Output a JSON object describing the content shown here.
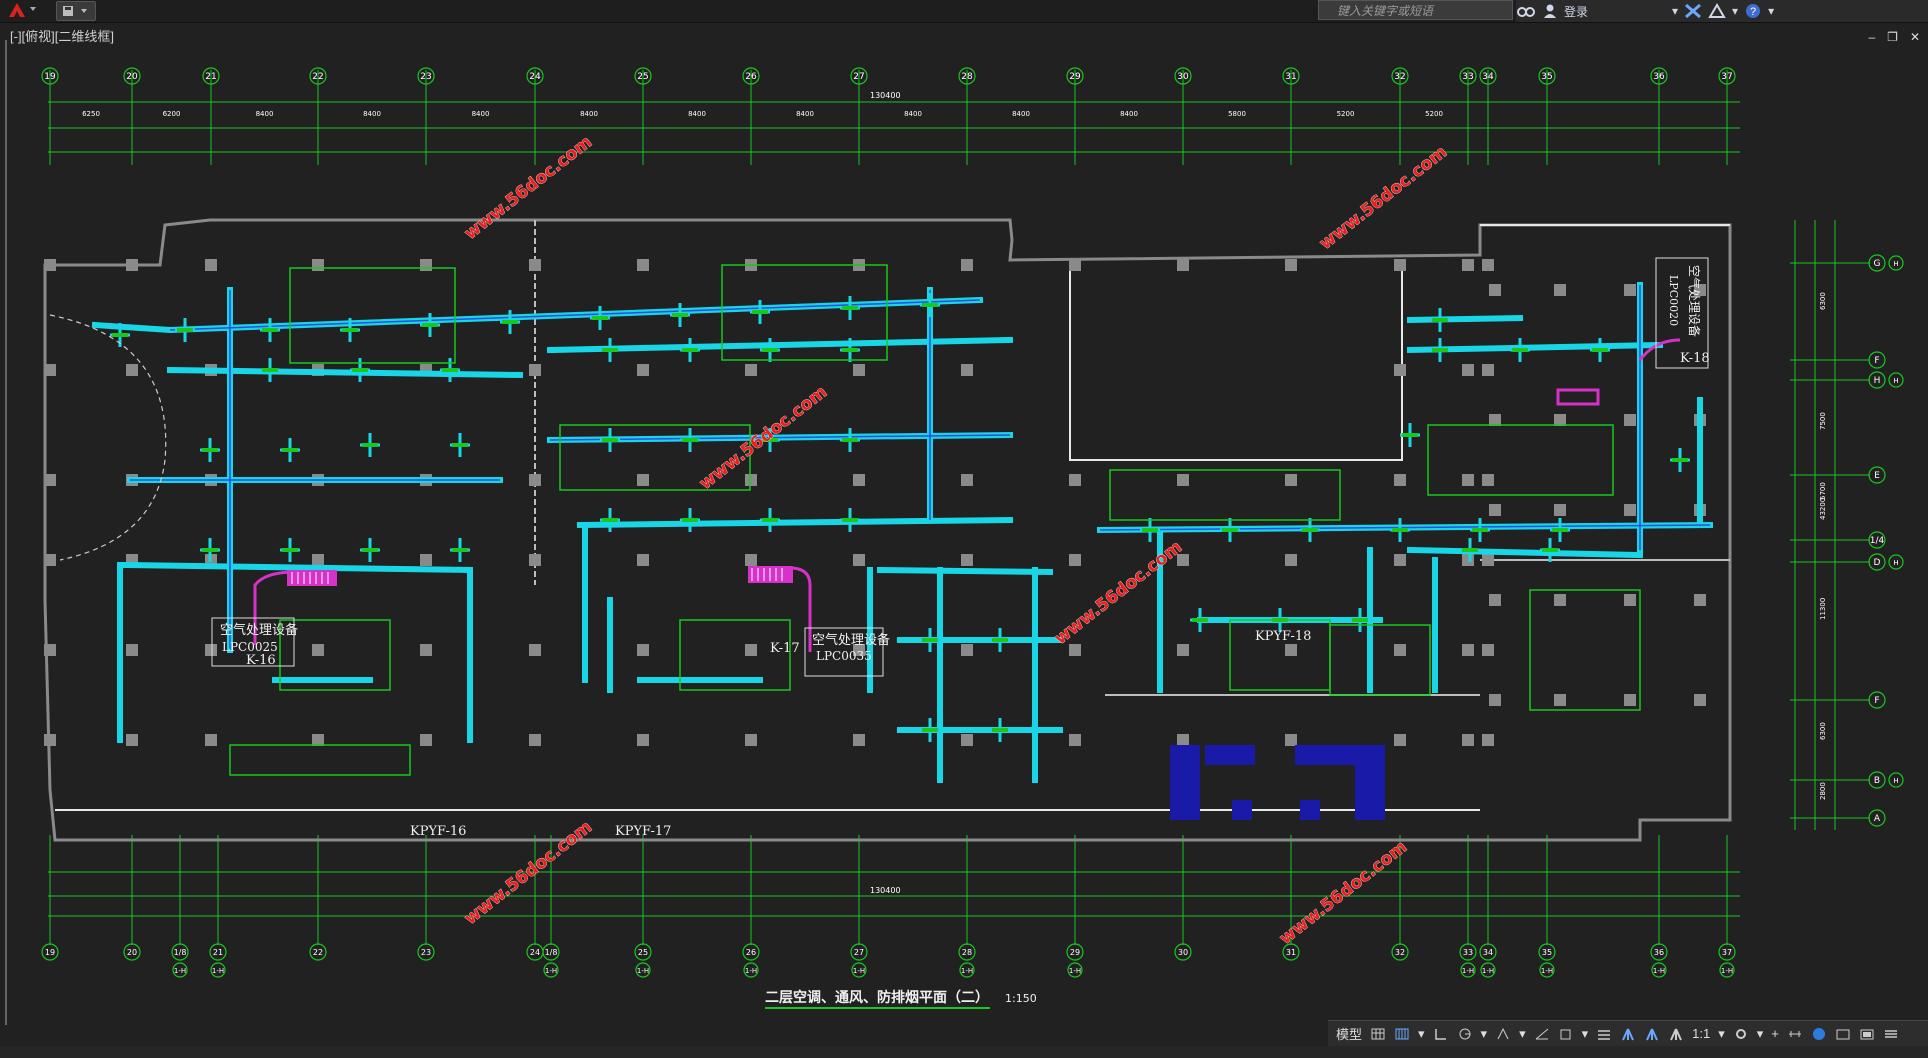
{
  "titlebar": {
    "search_placeholder": "键入关键字或短语",
    "login_label": "登录",
    "viewport_label": "[-][俯视][二维线框]"
  },
  "drawing": {
    "title": "二层空调、通风、防排烟平面（二）",
    "scale": "1:150",
    "watermark": "www.56doc.com",
    "grid_top": [
      "19",
      "20",
      "21",
      "22",
      "23",
      "24",
      "25",
      "26",
      "27",
      "28",
      "29",
      "30",
      "31",
      "32",
      "33",
      "34",
      "35",
      "36",
      "37"
    ],
    "grid_bottom": [
      "19",
      "20",
      "1/8",
      "21",
      "22",
      "23",
      "24",
      "1/8",
      "25",
      "26",
      "27",
      "28",
      "29",
      "30",
      "31",
      "32",
      "33",
      "34",
      "35",
      "36",
      "37"
    ],
    "grid_bottom_sub": [
      "1-H",
      "1-H",
      "1-H",
      "1-H",
      "1-H",
      "1-H",
      "1-H",
      "1-H",
      "1-H",
      "1-H",
      "1-H",
      "1-H",
      "1-H"
    ],
    "grid_right": [
      "G",
      "F",
      "H",
      "E",
      "1/4",
      "D",
      "F",
      "B",
      "A"
    ],
    "grid_right_sub": [
      "H",
      "H",
      "H",
      "H",
      "H",
      "H"
    ],
    "total_dim": "130400",
    "top_dims": [
      "6250",
      "6200",
      "8400",
      "8400",
      "8400",
      "8400",
      "8400",
      "8400",
      "8400",
      "8400",
      "8400",
      "5800",
      "5200",
      "5200"
    ],
    "right_dims": [
      "6300",
      "7500",
      "5700",
      "11300",
      "6300",
      "2800",
      "43200"
    ],
    "equipment": [
      {
        "name": "空气处理设备",
        "model": "LPC0025",
        "tag": "K-16"
      },
      {
        "name": "空气处理设备",
        "model": "LPC0035",
        "tag": "K-17"
      },
      {
        "name": "空气处理设备",
        "model": "LPC0020",
        "tag": "K-18"
      }
    ],
    "fan_tags": [
      "KPYF-16",
      "KPYF-17",
      "KPYF-18"
    ]
  },
  "statusbar": {
    "model_label": "模型",
    "scale_label": "1:1"
  },
  "colors": {
    "background": "#212121",
    "axis_green": "#18c81e",
    "duct_cyan": "#19d6e6",
    "duct_blue": "#2b4de0",
    "wall_gray": "#8a8a8a",
    "wall_white": "#e8e8e8",
    "watermark_red": "#e8201e",
    "accent_magenta": "#d631c8"
  }
}
